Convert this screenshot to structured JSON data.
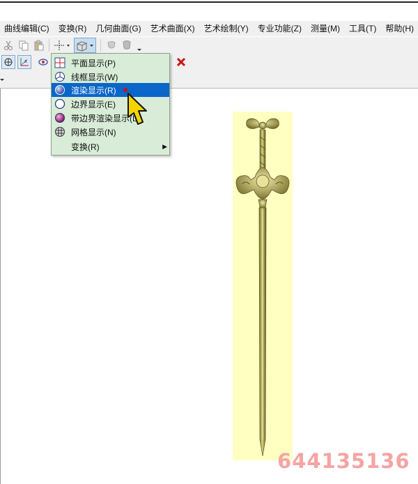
{
  "menubar": {
    "items": [
      {
        "label": "曲线编辑(C)"
      },
      {
        "label": "变换(R)"
      },
      {
        "label": "几何曲面(G)"
      },
      {
        "label": "艺术曲面(X)"
      },
      {
        "label": "艺术绘制(Y)"
      },
      {
        "label": "专业功能(Z)"
      },
      {
        "label": "测量(M)"
      },
      {
        "label": "工具(T)"
      },
      {
        "label": "帮助(H)"
      }
    ]
  },
  "render_menu": {
    "items": [
      {
        "label": "平面显示(P)",
        "icon": "plane-display-icon"
      },
      {
        "label": "线框显示(W)",
        "icon": "wireframe-display-icon"
      },
      {
        "label": "渲染显示(R)",
        "icon": "render-display-icon",
        "selected": true
      },
      {
        "label": "边界显示(E)",
        "icon": "boundary-display-icon"
      },
      {
        "label": "带边界渲染显示(L)",
        "icon": "render-with-boundary-icon"
      },
      {
        "label": "网格显示(N)",
        "icon": "mesh-display-icon"
      },
      {
        "label": "变换(R)",
        "icon": "",
        "submenu": true
      }
    ]
  },
  "watermark": {
    "text": "644135136"
  },
  "colors": {
    "menu_bg": "#d8ecd8",
    "selection": "#0a66c8",
    "sword_bg": "#ffffc2",
    "watermark": "#f6a4a4",
    "close_red": "#d01010"
  }
}
